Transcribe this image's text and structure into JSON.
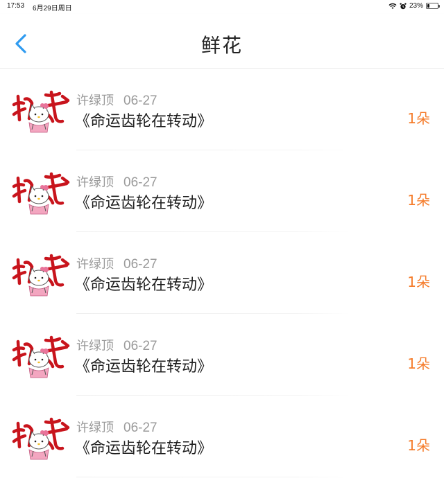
{
  "status_bar": {
    "time": "17:53",
    "date": "6月29日周日",
    "battery": "23%",
    "battery_level": 0.23
  },
  "header": {
    "title": "鲜花",
    "back_icon": "chevron-left-icon",
    "back_color": "#2f9bf0"
  },
  "items": [
    {
      "user": "许绿顶",
      "date": "06-27",
      "title": "《命运齿轮在转动》",
      "count": "1朵"
    },
    {
      "user": "许绿顶",
      "date": "06-27",
      "title": "《命运齿轮在转动》",
      "count": "1朵"
    },
    {
      "user": "许绿顶",
      "date": "06-27",
      "title": "《命运齿轮在转动》",
      "count": "1朵"
    },
    {
      "user": "许绿顶",
      "date": "06-27",
      "title": "《命运齿轮在转动》",
      "count": "1朵"
    },
    {
      "user": "许绿顶",
      "date": "06-27",
      "title": "《命运齿轮在转动》",
      "count": "1朵"
    }
  ],
  "colors": {
    "count": "#f57c2b",
    "meta": "#9a9a9a",
    "avatar_text": "#c8141c"
  }
}
